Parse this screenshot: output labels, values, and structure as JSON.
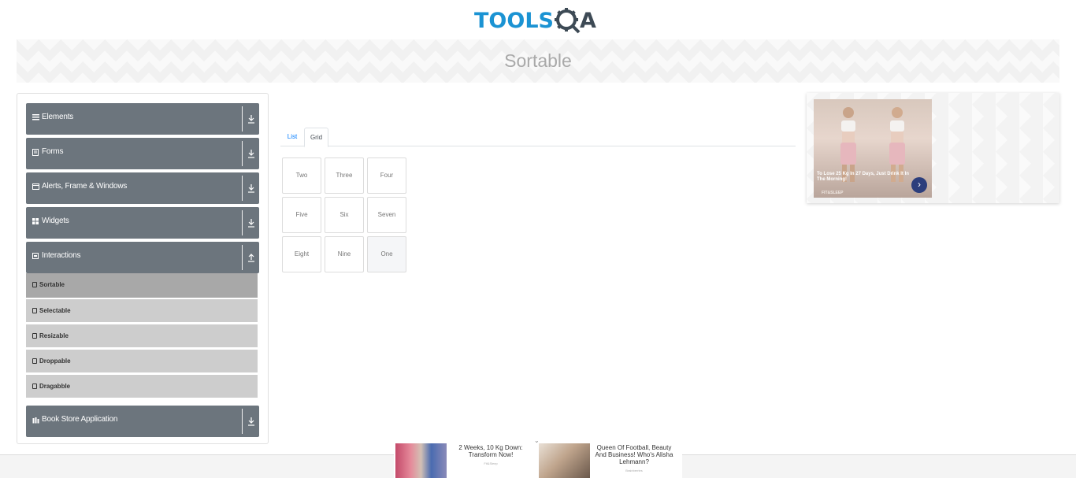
{
  "header": {
    "logo_tools": "TOOLS",
    "logo_a": "A",
    "page_title": "Sortable"
  },
  "sidebar": {
    "groups": [
      {
        "label": "Elements",
        "icon": "hamburger-icon"
      },
      {
        "label": "Forms",
        "icon": "document-icon"
      },
      {
        "label": "Alerts, Frame & Windows",
        "icon": "window-icon"
      },
      {
        "label": "Widgets",
        "icon": "grid-icon"
      },
      {
        "label": "Interactions",
        "icon": "interaction-icon",
        "expanded": true
      },
      {
        "label": "Book Store Application",
        "icon": "book-icon"
      }
    ],
    "sub_items": [
      {
        "label": "Sortable",
        "active": true
      },
      {
        "label": "Selectable"
      },
      {
        "label": "Resizable"
      },
      {
        "label": "Droppable"
      },
      {
        "label": "Dragabble"
      }
    ]
  },
  "main": {
    "tabs": [
      {
        "label": "List",
        "active": false
      },
      {
        "label": "Grid",
        "active": true
      }
    ],
    "grid_items": [
      "Two",
      "Three",
      "Four",
      "Five",
      "Six",
      "Seven",
      "Eight",
      "Nine",
      "One"
    ]
  },
  "ad_right": {
    "text": "To Lose 25 Kg In 27 Days, Just Drink It In The Morning!",
    "brand": "FIT&SLEEP",
    "cta_icon": "chevron-right-icon"
  },
  "bottom_ad": {
    "item1_title": "2 Weeks, 10 Kg Down: Transform Now!",
    "item1_source": "Fit&Sleep",
    "item2_title": "Queen Of Football, Beauty And Business! Who's Alisha Lehmann?",
    "item2_source": "Brainberries"
  },
  "colors": {
    "brand_blue": "#1b93d3",
    "sidebar_group_bg": "#6c757d",
    "sidebar_sub_bg": "#cdcdcd",
    "sidebar_sub_active_bg": "#a8a8a8",
    "tab_active_text": "#007bff"
  }
}
